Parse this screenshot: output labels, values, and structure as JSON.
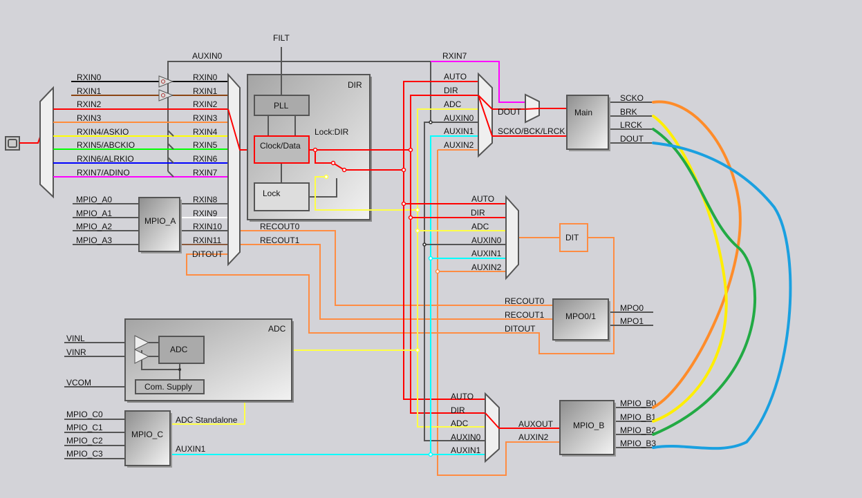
{
  "labels": {
    "filt": "FILT",
    "auxin0_top": "AUXIN0",
    "rxin7_top": "RXIN7",
    "inputs": [
      "RXIN0",
      "RXIN1",
      "RXIN2",
      "RXIN3",
      "RXIN4/ASKIO",
      "RXIN5/ABCKIO",
      "RXIN6/ALRKIO",
      "RXIN7/ADINO"
    ],
    "mux_in": [
      "RXIN0",
      "RXIN1",
      "RXIN2",
      "RXIN3",
      "RXIN4",
      "RXIN5",
      "RXIN6",
      "RXIN7",
      "RXIN8",
      "RXIN9",
      "RXIN10",
      "RXIN11",
      "DITOUT"
    ],
    "mpio_a": {
      "title": "MPIO_A",
      "inputs": [
        "MPIO_A0",
        "MPIO_A1",
        "MPIO_A2",
        "MPIO_A3"
      ]
    },
    "dir": {
      "title": "DIR",
      "pll": "PLL",
      "clock": "Clock/Data",
      "lock": "Lock",
      "lockdir": "Lock:DIR"
    },
    "recout": [
      "RECOUT0",
      "RECOUT1"
    ],
    "main_mux": [
      "AUTO",
      "DIR",
      "ADC",
      "AUXIN0",
      "AUXIN1",
      "AUXIN2"
    ],
    "dout": "DOUT",
    "scko": "SCKO/BCK/LRCK",
    "main": {
      "title": "Main",
      "outputs": [
        "SCKO",
        "BRK",
        "LRCK",
        "DOUT"
      ]
    },
    "dit_mux": [
      "AUTO",
      "DIR",
      "ADC",
      "AUXIN0",
      "AUXIN1",
      "AUXIN2"
    ],
    "dit": "DIT",
    "mpo": {
      "title": "MPO0/1",
      "inputs": [
        "RECOUT0",
        "RECOUT1",
        "DITOUT"
      ],
      "outputs": [
        "MPO0",
        "MPO1"
      ]
    },
    "adc": {
      "title": "ADC",
      "inner": "ADC",
      "supply": "Com. Supply",
      "inputs": [
        "VINL",
        "VINR",
        "VCOM"
      ]
    },
    "mpio_c": {
      "title": "MPIO_C",
      "inputs": [
        "MPIO_C0",
        "MPIO_C1",
        "MPIO_C2",
        "MPIO_C3"
      ],
      "outputs": [
        "ADC Standalone",
        "AUXIN1"
      ]
    },
    "aux_mux": [
      "AUTO",
      "DIR",
      "ADC",
      "AUXIN0",
      "AUXIN1"
    ],
    "mpio_b": {
      "title": "MPIO_B",
      "inputs": [
        "AUXOUT",
        "AUXIN2"
      ],
      "outputs": [
        "MPIO_B0",
        "MPIO_B1",
        "MPIO_B2",
        "MPIO_B3"
      ]
    }
  },
  "colors": {
    "background": "#d3d3d8",
    "dir_signal": "#ff0000",
    "adc_signal": "#ffff44",
    "auxin1": "#00ffff",
    "auxin2": "#ff8c42",
    "scko": "#ff8c2a",
    "brk": "#ffee00",
    "lrck": "#22aa44",
    "dout": "#1aa0e0"
  }
}
